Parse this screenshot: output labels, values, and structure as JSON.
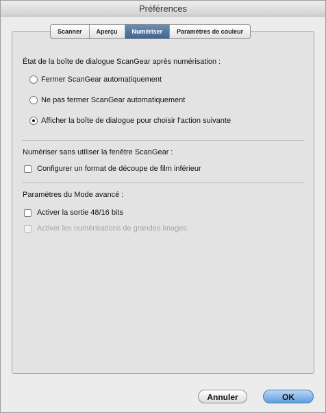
{
  "window": {
    "title": "Préférences"
  },
  "tabs": [
    {
      "label": "Scanner",
      "active": false
    },
    {
      "label": "Aperçu",
      "active": false
    },
    {
      "label": "Numériser",
      "active": true
    },
    {
      "label": "Paramètres de couleur",
      "active": false
    }
  ],
  "section_after_scan": {
    "title": "État de la boîte de dialogue ScanGear après numérisation :",
    "options": [
      {
        "label": "Fermer ScanGear automatiquement",
        "checked": false
      },
      {
        "label": "Ne pas fermer ScanGear automatiquement",
        "checked": false
      },
      {
        "label": "Afficher la boîte de dialogue pour choisir l'action suivante",
        "checked": true
      }
    ]
  },
  "section_no_window": {
    "title": "Numériser sans utiliser la fenêtre ScanGear :",
    "checkbox": {
      "label": "Configurer un format de découpe de film inférieur",
      "checked": false
    }
  },
  "section_advanced": {
    "title": "Paramètres du Mode avancé :",
    "checkbox1": {
      "label": "Activer la sortie 48/16 bits",
      "checked": false
    },
    "checkbox2": {
      "label": "Activer les numérisations de grandes images",
      "checked": false,
      "disabled": true
    }
  },
  "buttons": {
    "cancel": "Annuler",
    "ok": "OK"
  }
}
